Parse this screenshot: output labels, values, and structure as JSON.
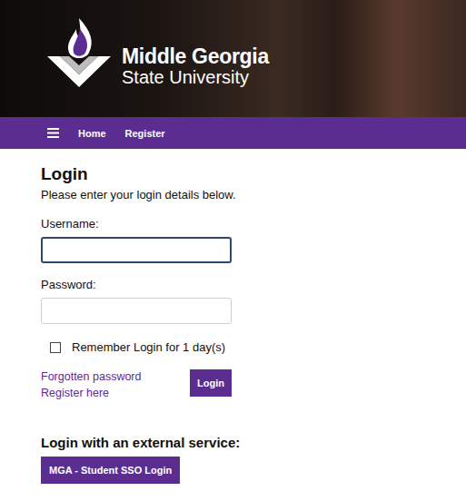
{
  "header": {
    "logo_line1": "Middle Georgia",
    "logo_line2": "State University"
  },
  "nav": {
    "items": [
      "Home",
      "Register"
    ]
  },
  "login": {
    "title": "Login",
    "subtitle": "Please enter your login details below.",
    "username": {
      "label": "Username:",
      "value": "",
      "focused": true
    },
    "password": {
      "label": "Password:",
      "value": "",
      "focused": false
    },
    "remember": {
      "label": "Remember Login for 1 day(s)",
      "checked": false
    },
    "links": [
      "Forgotten password",
      "Register here"
    ],
    "button": "Login"
  },
  "external": {
    "title": "Login with an external service:",
    "buttons": [
      "MGA - Student SSO Login"
    ]
  }
}
